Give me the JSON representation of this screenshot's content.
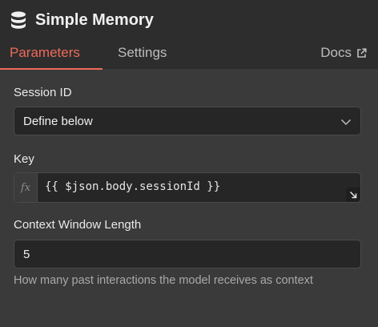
{
  "node": {
    "title": "Simple Memory",
    "icon": "database-icon"
  },
  "tabs": {
    "parameters": "Parameters",
    "settings": "Settings",
    "docs": "Docs",
    "active": "parameters"
  },
  "fields": {
    "session_id": {
      "label": "Session ID",
      "value": "Define below"
    },
    "key": {
      "label": "Key",
      "fx": "fx",
      "expression": "{{ $json.body.sessionId }}"
    },
    "context_window": {
      "label": "Context Window Length",
      "value": "5",
      "hint": "How many past interactions the model receives as context"
    }
  },
  "colors": {
    "accent": "#ee6a5b",
    "panel": "#3a3a3a",
    "header": "#2d2d2d",
    "input": "#262626"
  }
}
